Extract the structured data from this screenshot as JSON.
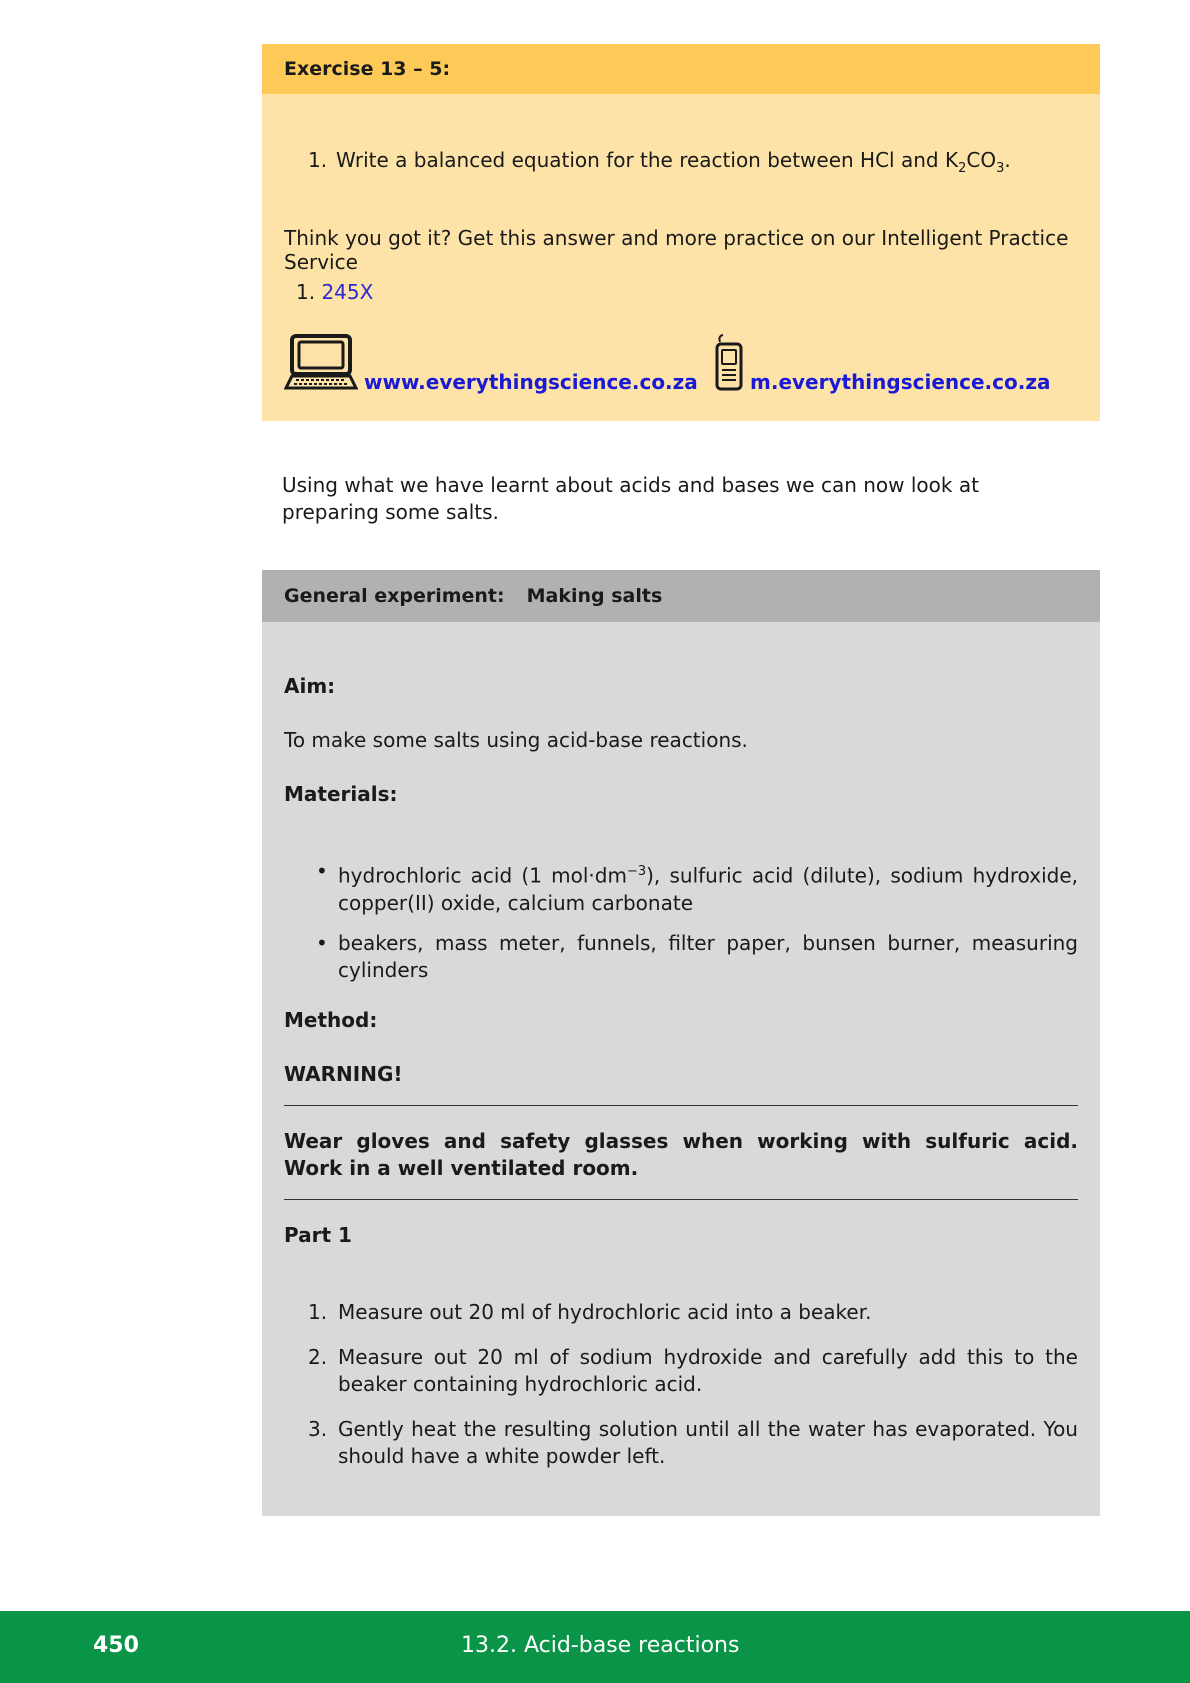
{
  "exercise": {
    "title": "Exercise 13 – 5:",
    "question_num": "1.",
    "question_text": "Write a balanced equation for the reaction between HCl and K",
    "question_sub1": "2",
    "question_mid": "CO",
    "question_sub2": "3",
    "question_end": ".",
    "think_text": "Think you got it? Get this answer and more practice on our Intelligent Practice Service",
    "answer_num": "1.",
    "answer_code": "245X",
    "web_link": "www.everythingscience.co.za",
    "mobile_link": "m.everythingscience.co.za"
  },
  "intro": "Using what we have learnt about acids and bases we can now look at preparing some salts.",
  "experiment": {
    "header_label": "General experiment:",
    "header_title": "Making salts",
    "aim_label": "Aim:",
    "aim_text": "To make some salts using acid-base reactions.",
    "materials_label": "Materials:",
    "material1_a": "hydrochloric acid (1 mol·dm",
    "material1_sup": "−3",
    "material1_b": "), sulfuric acid (dilute), sodium hydroxide, copper(II) oxide, calcium carbonate",
    "material2": "beakers, mass meter, funnels, filter paper, bunsen burner, measuring cylinders",
    "method_label": "Method:",
    "warning_label": "WARNING!",
    "warning_text": "Wear gloves and safety glasses when working with sulfuric acid.  Work in a well ventilated room.",
    "part_label": "Part 1",
    "steps": [
      {
        "num": "1.",
        "text": "Measure out 20 ml of hydrochloric acid into a beaker."
      },
      {
        "num": "2.",
        "text": "Measure out 20 ml of sodium hydroxide and carefully add this to the beaker containing hydrochloric acid."
      },
      {
        "num": "3.",
        "text": "Gently heat the resulting solution until all the water has evaporated. You should have a white powder left."
      }
    ]
  },
  "footer": {
    "page_number": "450",
    "section": "13.2.   Acid-base reactions"
  }
}
